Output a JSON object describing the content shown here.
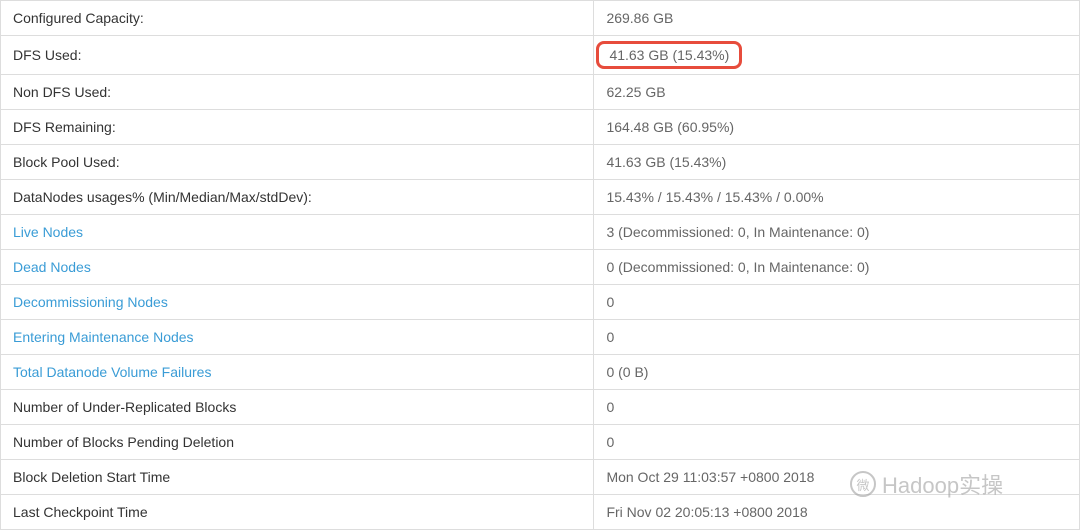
{
  "rows": [
    {
      "label": "Configured Capacity:",
      "value": "269.86 GB",
      "link": false,
      "highlight": false
    },
    {
      "label": "DFS Used:",
      "value": "41.63 GB (15.43%)",
      "link": false,
      "highlight": true
    },
    {
      "label": "Non DFS Used:",
      "value": "62.25 GB",
      "link": false,
      "highlight": false
    },
    {
      "label": "DFS Remaining:",
      "value": "164.48 GB (60.95%)",
      "link": false,
      "highlight": false
    },
    {
      "label": "Block Pool Used:",
      "value": "41.63 GB (15.43%)",
      "link": false,
      "highlight": false
    },
    {
      "label": "DataNodes usages% (Min/Median/Max/stdDev):",
      "value": "15.43% / 15.43% / 15.43% / 0.00%",
      "link": false,
      "highlight": false
    },
    {
      "label": "Live Nodes",
      "value": "3 (Decommissioned: 0, In Maintenance: 0)",
      "link": true,
      "highlight": false
    },
    {
      "label": "Dead Nodes",
      "value": "0 (Decommissioned: 0, In Maintenance: 0)",
      "link": true,
      "highlight": false
    },
    {
      "label": "Decommissioning Nodes",
      "value": "0",
      "link": true,
      "highlight": false
    },
    {
      "label": "Entering Maintenance Nodes",
      "value": "0",
      "link": true,
      "highlight": false
    },
    {
      "label": "Total Datanode Volume Failures",
      "value": "0 (0 B)",
      "link": true,
      "highlight": false
    },
    {
      "label": "Number of Under-Replicated Blocks",
      "value": "0",
      "link": false,
      "highlight": false
    },
    {
      "label": "Number of Blocks Pending Deletion",
      "value": "0",
      "link": false,
      "highlight": false
    },
    {
      "label": "Block Deletion Start Time",
      "value": "Mon Oct 29 11:03:57 +0800 2018",
      "link": false,
      "highlight": false
    },
    {
      "label": "Last Checkpoint Time",
      "value": "Fri Nov 02 20:05:13 +0800 2018",
      "link": false,
      "highlight": false
    }
  ],
  "watermark": {
    "icon_text": "微",
    "text": "Hadoop实操"
  }
}
